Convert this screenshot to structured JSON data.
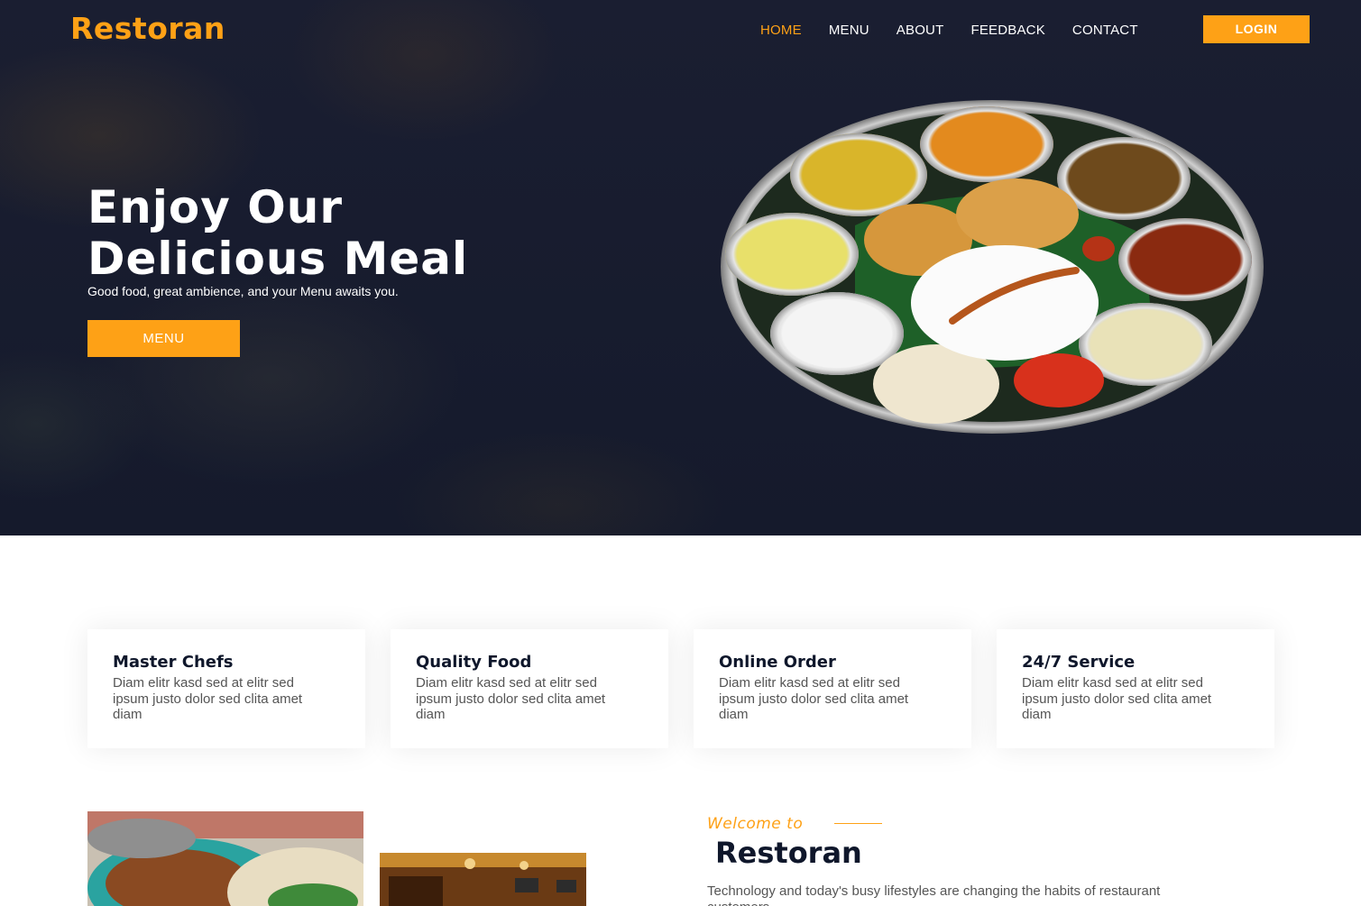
{
  "brand": {
    "name": "Restoran",
    "accent_color": "#fea116",
    "dark_color": "#0f172b"
  },
  "nav": {
    "items": [
      {
        "label": "HOME",
        "active": true
      },
      {
        "label": "MENU",
        "active": false
      },
      {
        "label": "ABOUT",
        "active": false
      },
      {
        "label": "FEEDBACK",
        "active": false
      },
      {
        "label": "CONTACT",
        "active": false
      }
    ],
    "login_label": "LOGIN"
  },
  "hero": {
    "title_line1": "Enjoy Our",
    "title_line2": "Delicious Meal",
    "subtitle": "Good food, great ambience, and your Menu awaits you.",
    "button_label": "MENU"
  },
  "services": [
    {
      "title": "Master Chefs",
      "text": "Diam elitr kasd sed at elitr sed ipsum justo dolor sed clita amet diam"
    },
    {
      "title": "Quality Food",
      "text": "Diam elitr kasd sed at elitr sed ipsum justo dolor sed clita amet diam"
    },
    {
      "title": "Online Order",
      "text": "Diam elitr kasd sed at elitr sed ipsum justo dolor sed clita amet diam"
    },
    {
      "title": "24/7 Service",
      "text": "Diam elitr kasd sed at elitr sed ipsum justo dolor sed clita amet diam"
    }
  ],
  "about": {
    "welcome_label": "Welcome to",
    "title": "Restoran",
    "text": "Technology and today's busy lifestyles are changing the habits of restaurant customers."
  }
}
